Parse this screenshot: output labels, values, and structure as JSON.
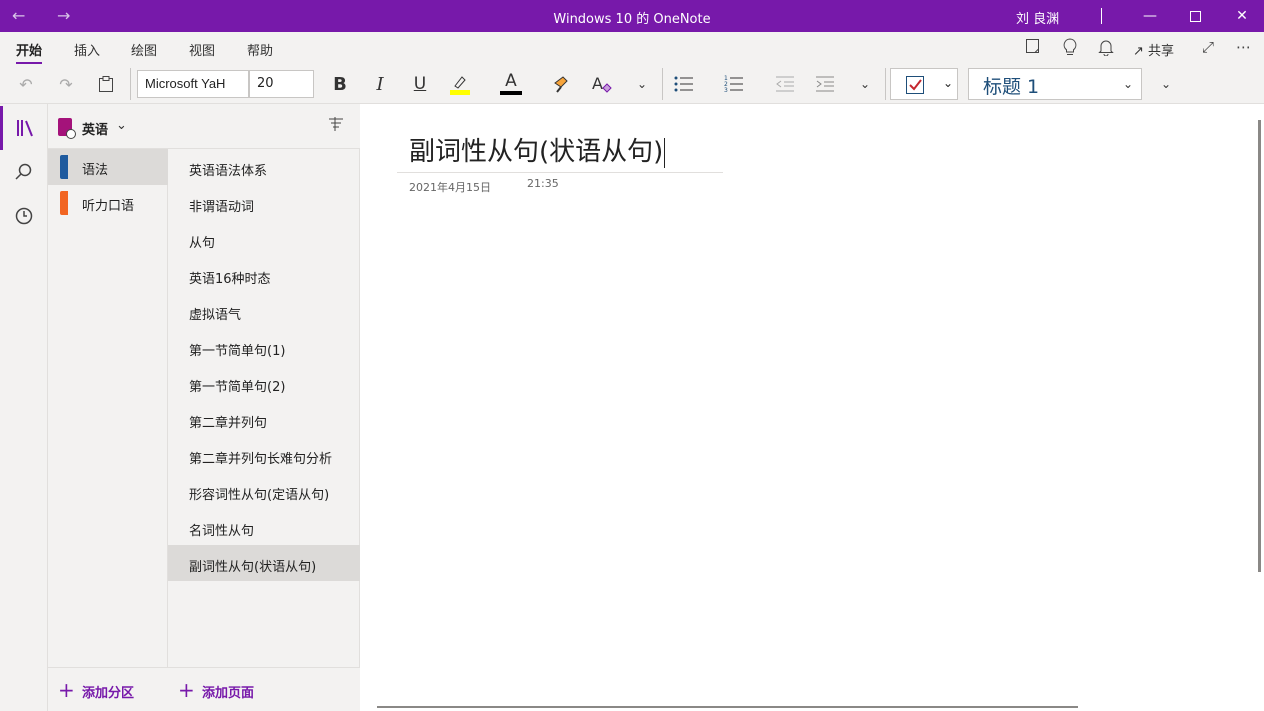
{
  "titlebar": {
    "title": "Windows 10 的 OneNote",
    "user": "刘 良渊",
    "back_icon": "arrow-left-icon",
    "forward_icon": "arrow-right-icon"
  },
  "ribbon": {
    "tabs": [
      "开始",
      "插入",
      "绘图",
      "视图",
      "帮助"
    ],
    "active_tab": "开始",
    "share_label": "共享"
  },
  "toolbar": {
    "font_name": "Microsoft YaH",
    "font_size": "20",
    "bold": "B",
    "italic": "I",
    "underline": "U",
    "font_color_glyph": "A",
    "highlight_color": "#ffff00",
    "font_color": "#000000",
    "style": "标题 1"
  },
  "notebook": {
    "name": "英语",
    "sections": [
      {
        "label": "语法",
        "color": "#1f5a9e",
        "active": true
      },
      {
        "label": "听力口语",
        "color": "#f26522",
        "active": false
      }
    ],
    "pages": [
      "英语语法体系",
      "非谓语动词",
      "从句",
      "英语16种时态",
      "虚拟语气",
      "第一节简单句(1)",
      "第一节简单句(2)",
      "第二章并列句",
      "第二章并列句长难句分析",
      "形容词性从句(定语从句)",
      "名词性从句",
      "副词性从句(状语从句)"
    ],
    "active_page_index": 11,
    "add_section": "添加分区",
    "add_page": "添加页面"
  },
  "note": {
    "title": "副词性从句(状语从句)",
    "date": "2021年4月15日",
    "time": "21:35"
  },
  "colors": {
    "brand": "#7719aa",
    "panel": "#f3f2f1",
    "selected": "#dcdad8"
  }
}
